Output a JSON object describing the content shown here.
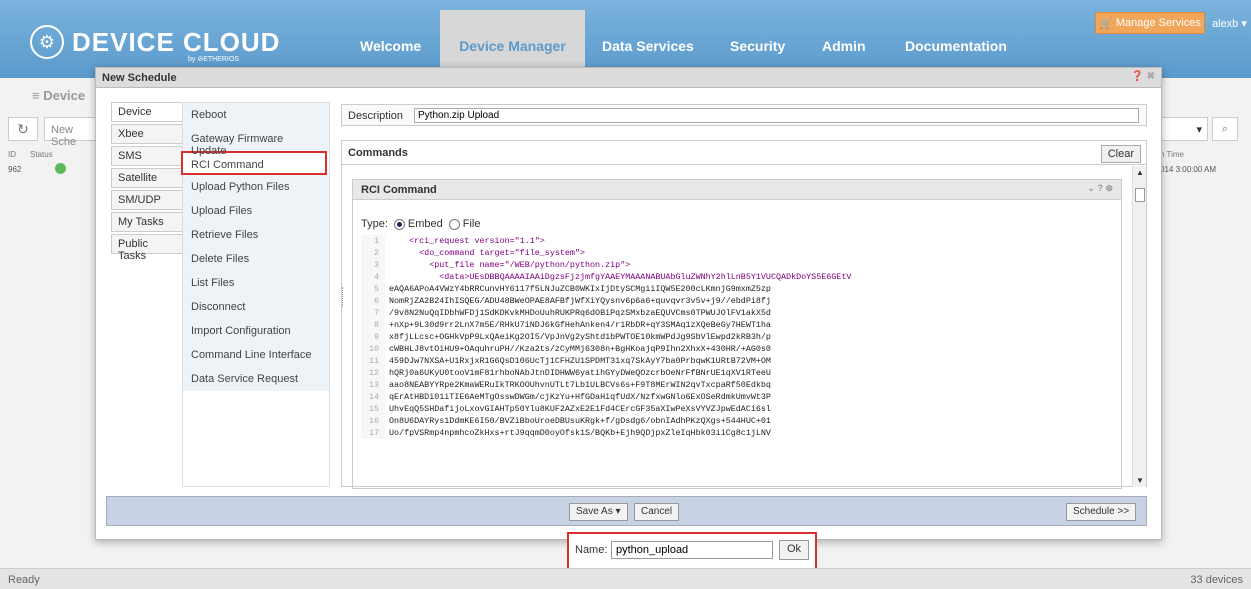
{
  "header": {
    "brand": "DEVICE CLOUD",
    "brand_by": "by ⊘ETHERIOS",
    "nav": [
      "Welcome",
      "Device Manager",
      "Data Services",
      "Security",
      "Admin",
      "Documentation"
    ],
    "manage_services": "Manage Services",
    "user": "alexb ▾"
  },
  "background": {
    "title": "Device",
    "search_placeholder": "New Sche",
    "col_id": "ID",
    "col_status": "Status",
    "row_id": "962",
    "time_header": "n Time",
    "time_value": "014 3:00:00 AM"
  },
  "dialog": {
    "title": "New Schedule",
    "tabs": [
      "Device",
      "Xbee",
      "SMS",
      "Satellite",
      "SM/UDP",
      "My Tasks",
      "Public Tasks"
    ],
    "tasks": [
      "Reboot",
      "Gateway Firmware Update",
      "RCI Command",
      "Upload Python Files",
      "Upload Files",
      "Retrieve Files",
      "Delete Files",
      "List Files",
      "Disconnect",
      "Import Configuration",
      "Command Line Interface",
      "Data Service Request"
    ],
    "description_label": "Description",
    "description_value": "Python.zip Upload",
    "commands_label": "Commands",
    "clear_label": "Clear",
    "rci_title": "RCI Command",
    "type_label": "Type:",
    "embed_label": "Embed",
    "file_label": "File",
    "code_lines": [
      {
        "n": "1",
        "t": "    <rci_request version=\"1.1\">"
      },
      {
        "n": "2",
        "t": "      <do_command target=\"file_system\">"
      },
      {
        "n": "3",
        "t": "        <put_file name=\"/WEB/python/python.zip\">"
      },
      {
        "n": "4",
        "t": "          <data>UEsDBBQAAAAIAAiDgzsFjzjmfgYAAEYMAAANABUAbGluZWNhY2hlLnB5Y1VUCQADkDoYS5E6GEtV"
      },
      {
        "n": "5",
        "t": "eAQA6APoA4VWzY4bRRCunvHY6117f5LNJuZCB0WKIxIjDtySCMgiiIQW5E200cLKmnjG9mxmZ5zp"
      },
      {
        "n": "6",
        "t": "NomRjZA2B24IhISQEG/ADU48BWeOPAE8AFBfjWfXiYQysnv6p6a6+quvqvr3v5v+j9//ebdPi8fj"
      },
      {
        "n": "7",
        "t": "/9v8N2NuQqIDbhWFDj1SdKDKvkMHDoUuhRUKPRq6dOBiPqzSMxbzaEQUVCms0TPWUJOlFV1akX5d"
      },
      {
        "n": "8",
        "t": "+nXp+9L30d9rr2LnX7m5E/RHkU7iNDJ6kGfHehAnken4/r1RbDR+qY3SMAq1zXQeBeGy7HEWT1ha"
      },
      {
        "n": "9",
        "t": "x8fjLLcsc+OGHkVpP9LxQAeiKg2OI5/VpJnVg2yShtd1bPWTOE10kmWPdJg9SbVlEwpd2kRB3h/p"
      },
      {
        "n": "10",
        "t": "cWBHLJ8vtOiHU9+OAquhruPH//Kza2ts/zCyMMj6308n+BgHKoajqP9Ihn2XhxX+430HR/+AG0s0"
      },
      {
        "n": "11",
        "t": "459DJw7NXSA+U1RxjxR1G6QsD106UcTj1CFHZU1SPDMT31xq7SkAyY7ba0PrbqwK1URtB72VM+OM"
      },
      {
        "n": "12",
        "t": "hQRj0a6UKyU0tooV1mF81rhboNAbJtnDIDHWW6yatihGYyDWeQOzcrbOeNrFfBNrUE1qXV1RTeeU"
      },
      {
        "n": "13",
        "t": "aao8NEABYYRpe2KmaWERuIkTRKOOUhvnUTLt7Lb1ULBCVs6s+F9T8MErWIN2qvTxcpaRf50Edkbq"
      },
      {
        "n": "14",
        "t": "qErAtHBDi01iTIE6AeMTgOsswDWGm/cjKzYu+HfGDaHiqfUdX/NzfxwGNlo6ExOSeRdmkUmvWt3P"
      },
      {
        "n": "15",
        "t": "UhvEqQ5SHDafijoLxovGIAHTp50Ylu8KUF2AZxE2E1Fd4CErcGF35aXIwPeXsVYVZJpwEdACi6sl"
      },
      {
        "n": "16",
        "t": "On8U6DAYRys1DdmKE6I50/BVZiBboUroeDBUsuKRgk+f/gDsdg6/obnIAdhPKzQXgs+544HUC+01"
      },
      {
        "n": "17",
        "t": "Uo/fpVSRmp4npmhcoZkHxs+rtJ9qqmD0oyOfsk1S/BQKb+Ejh9QDjpxZleIqHbk03iiCg8c1jLNV"
      }
    ],
    "save_as_label": "Save As ▾",
    "cancel_label": "Cancel",
    "schedule_label": "Schedule >>"
  },
  "save_popup": {
    "name_label": "Name:",
    "name_value": "python_upload",
    "ok_label": "Ok"
  },
  "statusbar": {
    "left": "Ready",
    "right": "33 devices"
  }
}
